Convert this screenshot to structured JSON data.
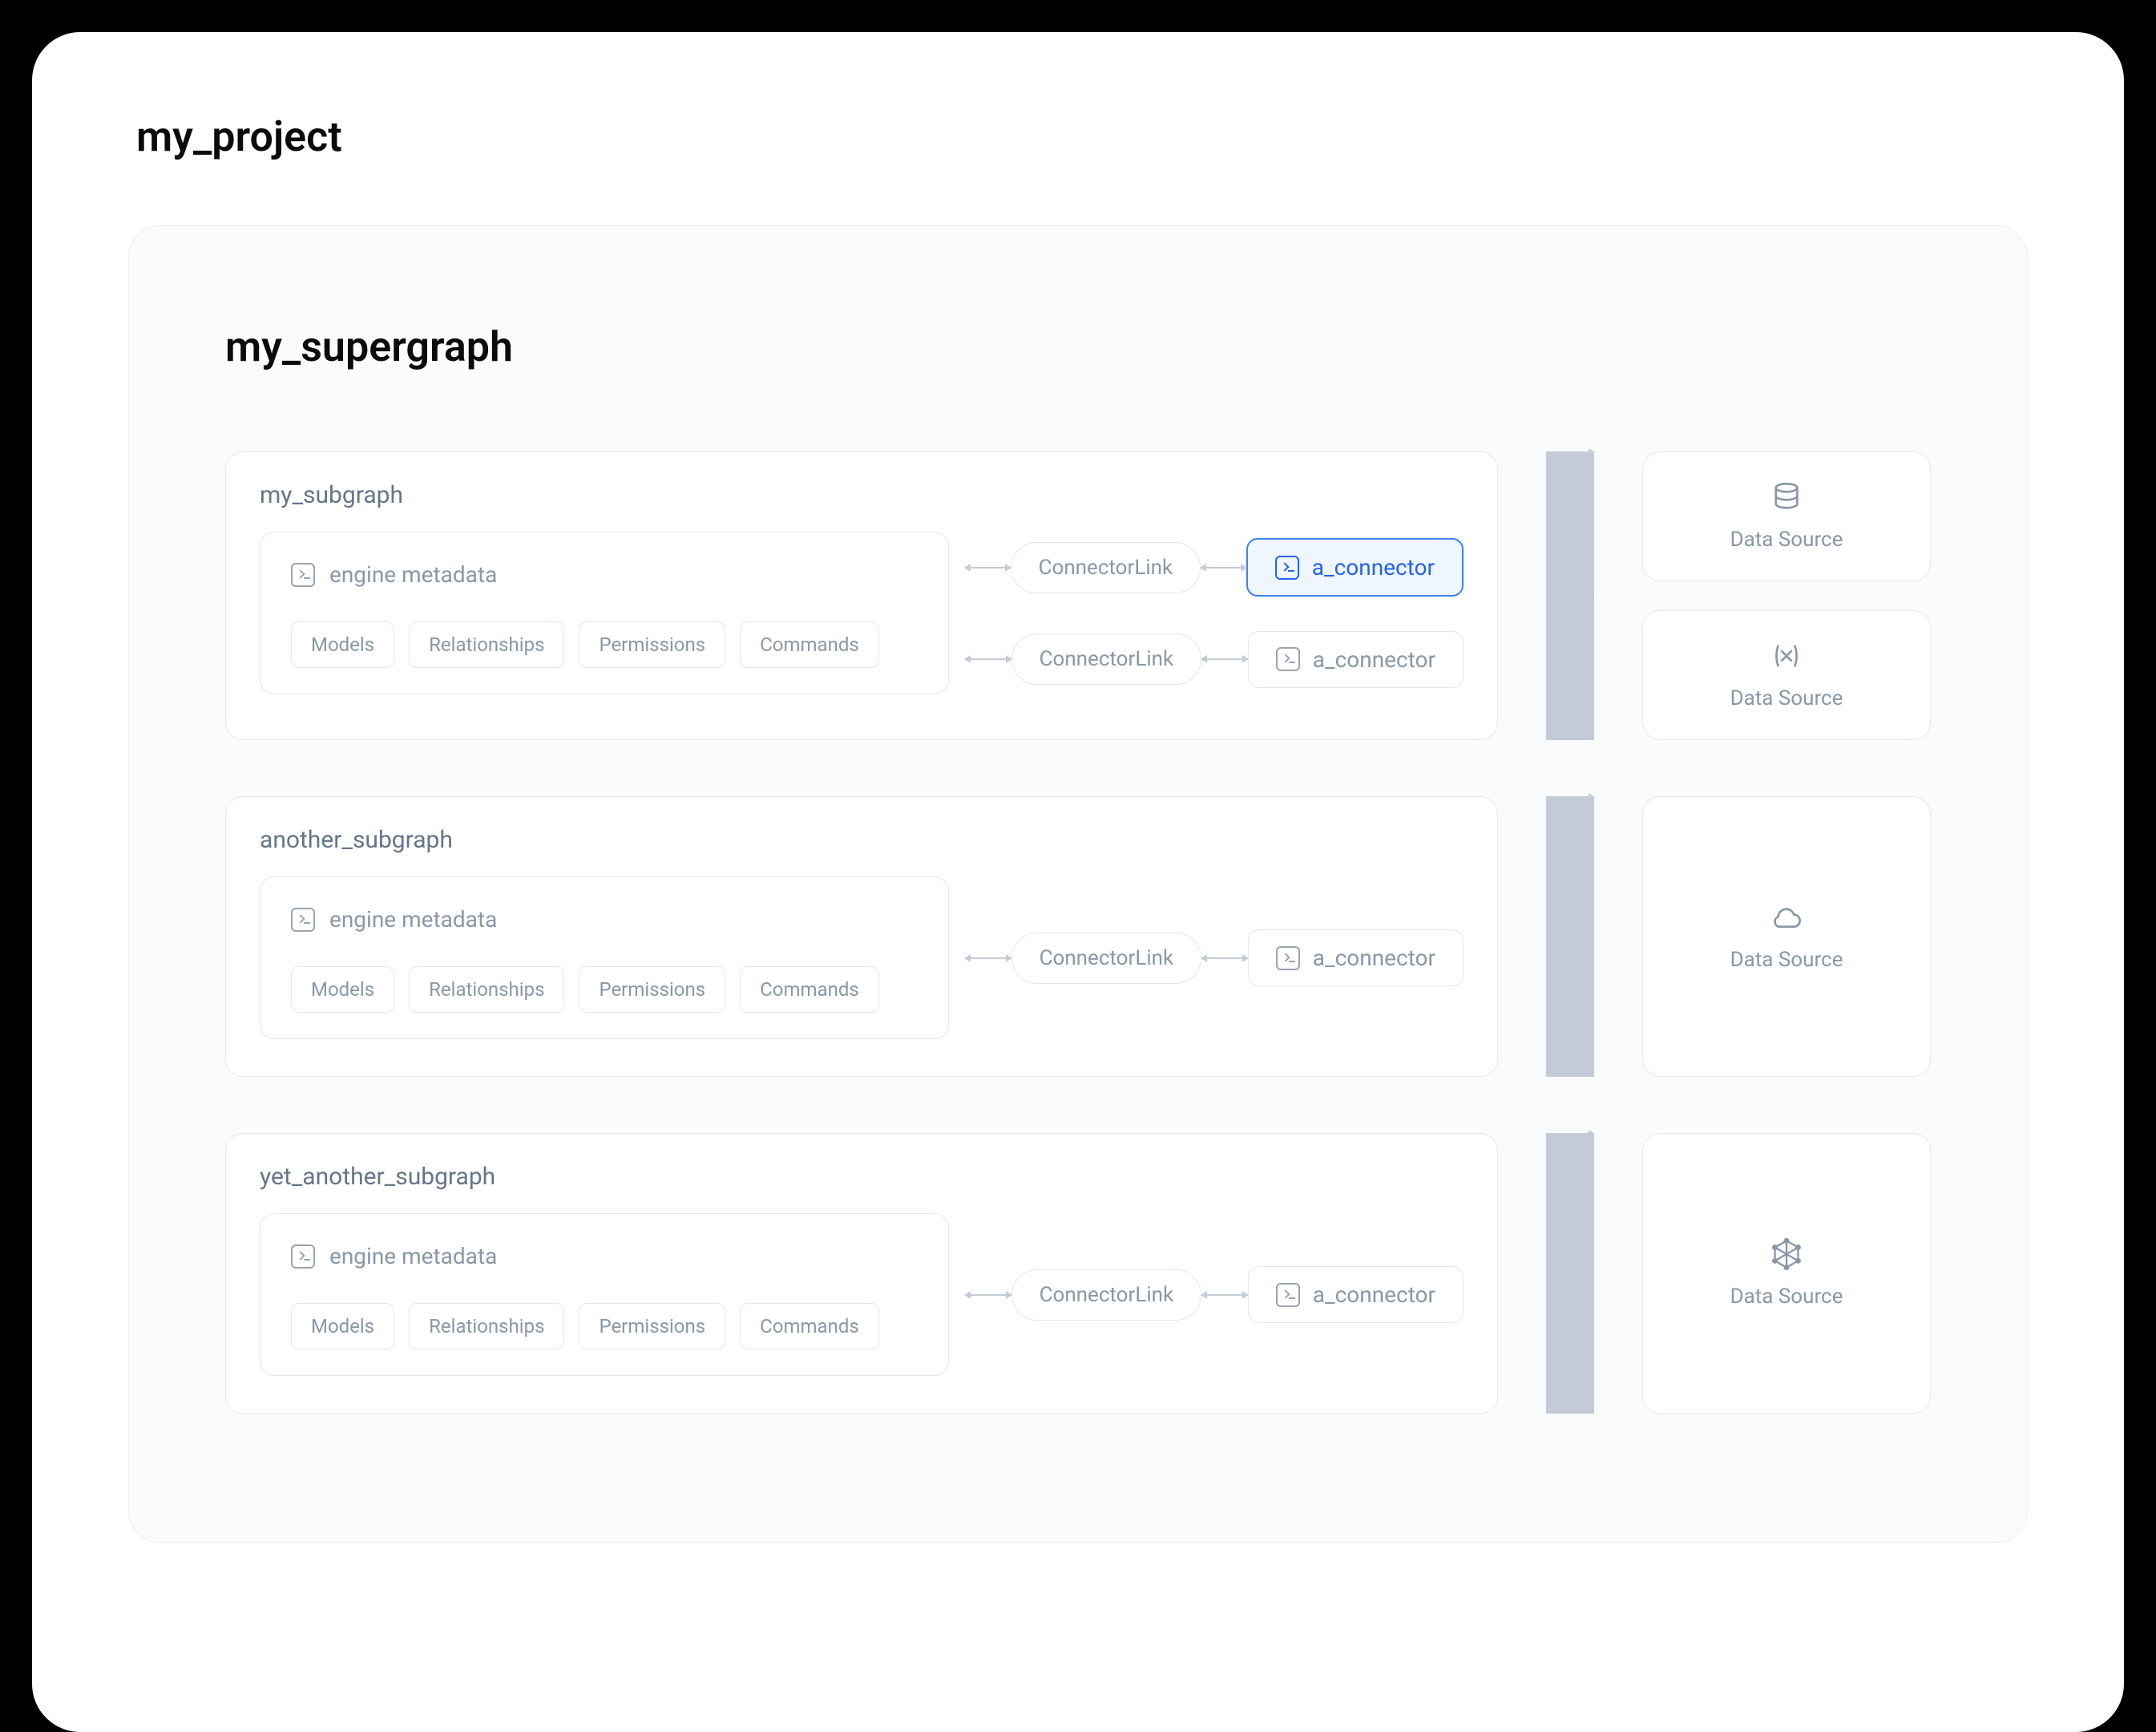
{
  "project": {
    "title": "my_project"
  },
  "supergraph": {
    "title": "my_supergraph",
    "subgraphs": [
      {
        "title": "my_subgraph",
        "engine": {
          "label": "engine metadata",
          "tags": [
            "Models",
            "Relationships",
            "Permissions",
            "Commands"
          ]
        },
        "links": [
          {
            "link_label": "ConnectorLink",
            "connector_label": "a_connector",
            "selected": true
          },
          {
            "link_label": "ConnectorLink",
            "connector_label": "a_connector",
            "selected": false
          }
        ],
        "datasources": [
          {
            "label": "Data Source",
            "icon": "database"
          },
          {
            "label": "Data Source",
            "icon": "variable"
          }
        ]
      },
      {
        "title": "another_subgraph",
        "engine": {
          "label": "engine metadata",
          "tags": [
            "Models",
            "Relationships",
            "Permissions",
            "Commands"
          ]
        },
        "links": [
          {
            "link_label": "ConnectorLink",
            "connector_label": "a_connector",
            "selected": false
          }
        ],
        "datasources": [
          {
            "label": "Data Source",
            "icon": "cloud"
          }
        ]
      },
      {
        "title": "yet_another_subgraph",
        "engine": {
          "label": "engine metadata",
          "tags": [
            "Models",
            "Relationships",
            "Permissions",
            "Commands"
          ]
        },
        "links": [
          {
            "link_label": "ConnectorLink",
            "connector_label": "a_connector",
            "selected": false
          }
        ],
        "datasources": [
          {
            "label": "Data Source",
            "icon": "graphql"
          }
        ]
      }
    ]
  }
}
